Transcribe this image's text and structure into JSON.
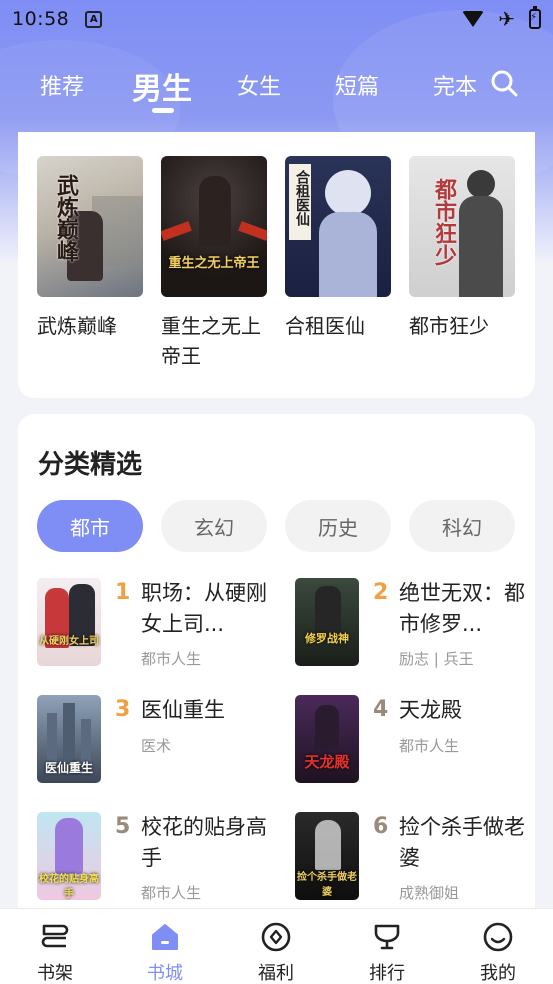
{
  "status_bar": {
    "time": "10:58",
    "notification_glyph": "A"
  },
  "top_tabs": [
    {
      "label": "推荐",
      "active": false
    },
    {
      "label": "男生",
      "active": true
    },
    {
      "label": "女生",
      "active": false
    },
    {
      "label": "短篇",
      "active": false
    },
    {
      "label": "完本",
      "active": false
    }
  ],
  "featured_books": [
    {
      "title": "武炼巅峰",
      "cover_text": "武炼巅峰"
    },
    {
      "title": "重生之无上帝王",
      "cover_text": "重生之无上帝王"
    },
    {
      "title": "合租医仙",
      "cover_text": "合租医仙"
    },
    {
      "title": "都市狂少",
      "cover_text": "都市狂少"
    }
  ],
  "category_section": {
    "title": "分类精选",
    "chips": [
      {
        "label": "都市",
        "active": true
      },
      {
        "label": "玄幻",
        "active": false
      },
      {
        "label": "历史",
        "active": false
      },
      {
        "label": "科幻",
        "active": false
      }
    ],
    "ranked_books": [
      {
        "rank": "1",
        "title": "职场：从硬刚女上司...",
        "tag": "都市人生",
        "cover_text": "从硬刚女上司"
      },
      {
        "rank": "2",
        "title": "绝世无双：都市修罗...",
        "tag": "励志 | 兵王",
        "cover_text": "修罗战神"
      },
      {
        "rank": "3",
        "title": "医仙重生",
        "tag": "医术",
        "cover_text": "医仙重生"
      },
      {
        "rank": "4",
        "title": "天龙殿",
        "tag": "都市人生",
        "cover_text": "天龙殿"
      },
      {
        "rank": "5",
        "title": "校花的贴身高手",
        "tag": "都市人生",
        "cover_text": "校花的贴身高手"
      },
      {
        "rank": "6",
        "title": "捡个杀手做老婆",
        "tag": "成熟御姐",
        "cover_text": "捡个杀手做老婆"
      }
    ]
  },
  "bottom_nav": [
    {
      "label": "书架",
      "icon": "bookshelf-icon",
      "active": false
    },
    {
      "label": "书城",
      "icon": "home-icon",
      "active": true
    },
    {
      "label": "福利",
      "icon": "welfare-icon",
      "active": false
    },
    {
      "label": "排行",
      "icon": "trophy-icon",
      "active": false
    },
    {
      "label": "我的",
      "icon": "smile-icon",
      "active": false
    }
  ],
  "colors": {
    "accent": "#7f8ef5",
    "rank_top": "#f0a040",
    "rank_other": "#9a8a7a"
  }
}
